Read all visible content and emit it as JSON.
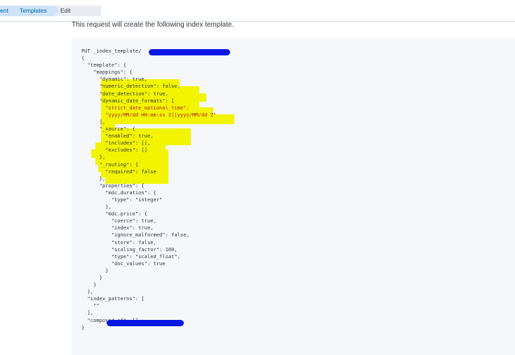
{
  "breadcrumb": {
    "items": [
      "ent",
      "Templates",
      "Edit template"
    ]
  },
  "intro_text": "This request will create the following index template.",
  "code_lines": [
    "PUT _index_template/",
    "{",
    "  \"template\": {",
    "    \"mappings\": {",
    "      \"dynamic\": true,",
    "      \"numeric_detection\": false,",
    "      \"date_detection\": true,",
    "      \"dynamic_date_formats\": [",
    "        \"strict_date_optional_time\",",
    "        \"yyyy/MM/dd HH:mm:ss Z||yyyy/MM/dd Z\"",
    "      ],",
    "      \"_source\": {",
    "        \"enabled\": true,",
    "        \"includes\": [],",
    "        \"excludes\": []",
    "      },",
    "      \"_routing\": {",
    "        \"required\": false",
    "      },",
    "      \"properties\": {",
    "        \"mdc.duration\": {",
    "          \"type\": \"integer\"",
    "        },",
    "        \"mdc.price\": {",
    "          \"coerce\": true,",
    "          \"index\": true,",
    "          \"ignore_malformed\": false,",
    "          \"store\": false,",
    "          \"scaling_factor\": 100,",
    "          \"type\": \"scaled_float\",",
    "          \"doc_values\": true",
    "        }",
    "      }",
    "    }",
    "  },",
    "  \"index_patterns\": [",
    "    \"\"",
    "  ],",
    "  \"composed_of\": []",
    "}"
  ],
  "colors": {
    "highlight": "#f2f400",
    "redaction": "#0a16e6",
    "panel": "#f5f7fa"
  }
}
